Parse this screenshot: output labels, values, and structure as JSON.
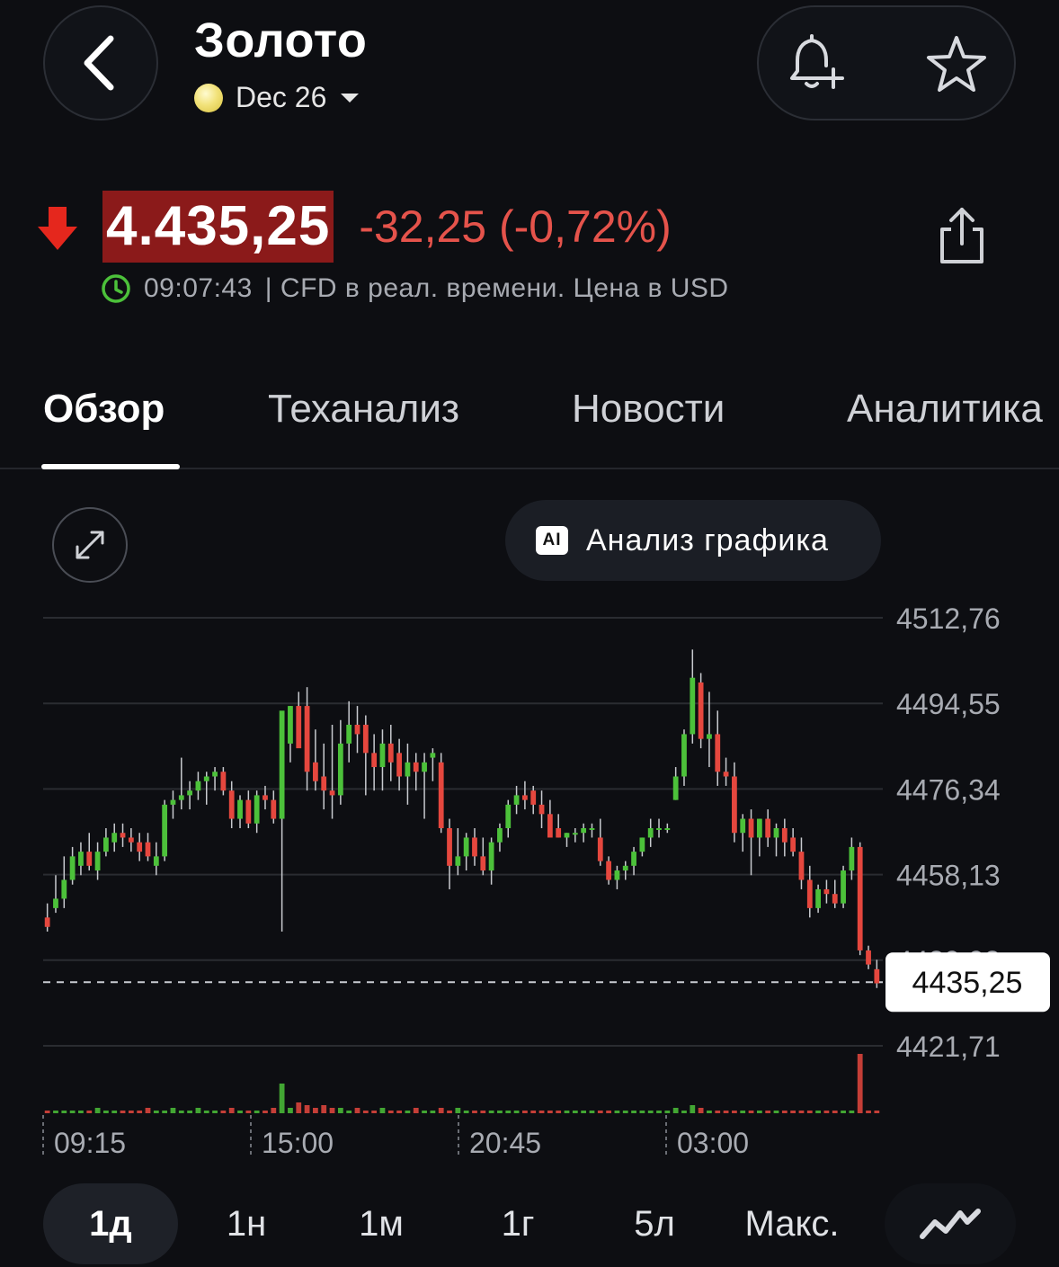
{
  "header": {
    "title": "Золото",
    "contract": "Dec 26"
  },
  "quote": {
    "price": "4.435,25",
    "change": "-32,25 (-0,72%)",
    "time": "09:07:43",
    "info": "| CFD в реал. времени. Цена в USD",
    "direction": "down"
  },
  "tabs": [
    {
      "label": "Обзор",
      "active": true
    },
    {
      "label": "Теханализ",
      "active": false
    },
    {
      "label": "Новости",
      "active": false
    },
    {
      "label": "Аналитика",
      "active": false
    }
  ],
  "chart_tools": {
    "ai_label": "Анализ графика",
    "ai_badge": "AI"
  },
  "chart_data": {
    "type": "candlestick",
    "y_ticks": [
      "4512,76",
      "4494,55",
      "4476,34",
      "4458,13",
      "4439,92",
      "4421,71"
    ],
    "y_tick_values": [
      4512.76,
      4494.55,
      4476.34,
      4458.13,
      4439.92,
      4421.71
    ],
    "x_ticks": [
      "09:15",
      "15:00",
      "20:45",
      "03:00"
    ],
    "last_price_label": "4435,25",
    "last_price": 4435.25,
    "ylim": [
      4421.71,
      4512.76
    ],
    "colors": {
      "up": "#4cc13a",
      "down": "#e5473e",
      "grid": "#2a2c31",
      "axis_text": "#a8abb2"
    },
    "ohlc": [
      [
        4449,
        4452,
        4446,
        4447
      ],
      [
        4451,
        4458,
        4450,
        4453
      ],
      [
        4453,
        4462,
        4451,
        4457
      ],
      [
        4457,
        4464,
        4456,
        4462
      ],
      [
        4460,
        4465,
        4458,
        4463
      ],
      [
        4463,
        4467,
        4459,
        4460
      ],
      [
        4459,
        4465,
        4457,
        4463
      ],
      [
        4463,
        4468,
        4462,
        4466
      ],
      [
        4465,
        4469,
        4463,
        4467
      ],
      [
        4467,
        4469,
        4464,
        4466
      ],
      [
        4466,
        4468,
        4463,
        4465
      ],
      [
        4465,
        4467,
        4461,
        4463
      ],
      [
        4465,
        4467,
        4461,
        4462
      ],
      [
        4460,
        4465,
        4458,
        4462
      ],
      [
        4462,
        4474,
        4461,
        4473
      ],
      [
        4473,
        4476,
        4470,
        4474
      ],
      [
        4474,
        4483,
        4472,
        4475
      ],
      [
        4475,
        4478,
        4472,
        4476
      ],
      [
        4476,
        4480,
        4474,
        4478
      ],
      [
        4478,
        4480,
        4473,
        4479
      ],
      [
        4479,
        4481,
        4476,
        4480
      ],
      [
        4480,
        4481,
        4475,
        4476
      ],
      [
        4476,
        4478,
        4468,
        4470
      ],
      [
        4470,
        4475,
        4468,
        4474
      ],
      [
        4474,
        4476,
        4468,
        4469
      ],
      [
        4469,
        4476,
        4467,
        4475
      ],
      [
        4475,
        4477,
        4472,
        4474
      ],
      [
        4474,
        4476,
        4469,
        4470
      ],
      [
        4470,
        4475,
        4446,
        4493
      ],
      [
        4486,
        4494,
        4482,
        4494
      ],
      [
        4494,
        4497,
        4488,
        4485
      ],
      [
        4494,
        4498,
        4476,
        4480
      ],
      [
        4482,
        4489,
        4476,
        4478
      ],
      [
        4479,
        4486,
        4472,
        4476
      ],
      [
        4476,
        4490,
        4470,
        4475
      ],
      [
        4475,
        4491,
        4473,
        4486
      ],
      [
        4486,
        4495,
        4482,
        4490
      ],
      [
        4490,
        4494,
        4484,
        4488
      ],
      [
        4490,
        4492,
        4475,
        4484
      ],
      [
        4484,
        4488,
        4476,
        4481
      ],
      [
        4481,
        4489,
        4476,
        4486
      ],
      [
        4486,
        4490,
        4478,
        4482
      ],
      [
        4484,
        4487,
        4476,
        4479
      ],
      [
        4479,
        4486,
        4473,
        4482
      ],
      [
        4482,
        4484,
        4476,
        4480
      ],
      [
        4480,
        4484,
        4470,
        4482
      ],
      [
        4483,
        4485,
        4478,
        4484
      ],
      [
        4482,
        4484,
        4467,
        4468
      ],
      [
        4468,
        4470,
        4455,
        4460
      ],
      [
        4460,
        4468,
        4458,
        4462
      ],
      [
        4462,
        4467,
        4459,
        4466
      ],
      [
        4466,
        4468,
        4460,
        4462
      ],
      [
        4462,
        4466,
        4458,
        4459
      ],
      [
        4459,
        4466,
        4456,
        4465
      ],
      [
        4465,
        4469,
        4463,
        4468
      ],
      [
        4468,
        4474,
        4466,
        4473
      ],
      [
        4473,
        4477,
        4471,
        4475
      ],
      [
        4475,
        4478,
        4472,
        4474
      ],
      [
        4476,
        4477,
        4471,
        4473
      ],
      [
        4473,
        4476,
        4468,
        4471
      ],
      [
        4471,
        4474,
        4468,
        4466
      ],
      [
        4468,
        4471,
        4466,
        4466
      ],
      [
        4466,
        4467,
        4464,
        4467
      ],
      [
        4467,
        4468,
        4465,
        4467
      ],
      [
        4467,
        4469,
        4465,
        4468
      ],
      [
        4468,
        4469,
        4466,
        4468
      ],
      [
        4466,
        4470,
        4460,
        4461
      ],
      [
        4461,
        4462,
        4456,
        4457
      ],
      [
        4457,
        4460,
        4455,
        4459
      ],
      [
        4459,
        4461,
        4457,
        4460
      ],
      [
        4460,
        4464,
        4458,
        4463
      ],
      [
        4463,
        4466,
        4462,
        4466
      ],
      [
        4466,
        4470,
        4464,
        4468
      ],
      [
        4468,
        4470,
        4466,
        4468
      ],
      [
        4468,
        4469,
        4467,
        4468
      ],
      [
        4474,
        4481,
        4474,
        4479
      ],
      [
        4479,
        4489,
        4477,
        4488
      ],
      [
        4488,
        4506,
        4486,
        4500
      ],
      [
        4499,
        4501,
        4485,
        4487
      ],
      [
        4487,
        4497,
        4481,
        4488
      ],
      [
        4488,
        4493,
        4477,
        4480
      ],
      [
        4480,
        4483,
        4477,
        4479
      ],
      [
        4479,
        4482,
        4465,
        4467
      ],
      [
        4467,
        4471,
        4463,
        4470
      ],
      [
        4470,
        4472,
        4458,
        4466
      ],
      [
        4466,
        4470,
        4462,
        4470
      ],
      [
        4470,
        4472,
        4464,
        4466
      ],
      [
        4466,
        4469,
        4462,
        4468
      ],
      [
        4468,
        4470,
        4462,
        4465
      ],
      [
        4466,
        4468,
        4462,
        4463
      ],
      [
        4463,
        4466,
        4455,
        4457
      ],
      [
        4457,
        4460,
        4449,
        4451
      ],
      [
        4451,
        4456,
        4450,
        4455
      ],
      [
        4455,
        4457,
        4452,
        4454
      ],
      [
        4454,
        4457,
        4451,
        4452
      ],
      [
        4452,
        4460,
        4451,
        4459
      ],
      [
        4459,
        4466,
        4457,
        4464
      ],
      [
        4464,
        4465,
        4441,
        4442
      ],
      [
        4442,
        4443,
        4438,
        4439
      ],
      [
        4438,
        4440,
        4434,
        4435
      ]
    ],
    "volume": [
      1,
      1,
      1,
      1,
      1,
      1,
      2,
      1,
      1,
      1,
      1,
      1,
      2,
      1,
      1,
      2,
      1,
      1,
      2,
      1,
      1,
      1,
      2,
      1,
      1,
      1,
      1,
      2,
      11,
      2,
      4,
      3,
      2,
      3,
      2,
      2,
      1,
      2,
      1,
      1,
      2,
      1,
      1,
      1,
      2,
      1,
      1,
      2,
      1,
      2,
      1,
      1,
      1,
      1,
      1,
      1,
      1,
      1,
      1,
      1,
      1,
      1,
      1,
      1,
      1,
      1,
      1,
      1,
      1,
      1,
      1,
      1,
      1,
      1,
      1,
      2,
      1,
      3,
      2,
      1,
      1,
      1,
      1,
      1,
      1,
      1,
      1,
      1,
      1,
      1,
      1,
      1,
      1,
      1,
      1,
      1,
      1,
      22,
      1,
      1
    ]
  },
  "timeframes": [
    {
      "label": "1д",
      "active": true
    },
    {
      "label": "1н",
      "active": false
    },
    {
      "label": "1м",
      "active": false
    },
    {
      "label": "1г",
      "active": false
    },
    {
      "label": "5л",
      "active": false
    },
    {
      "label": "Макс.",
      "active": false
    }
  ]
}
